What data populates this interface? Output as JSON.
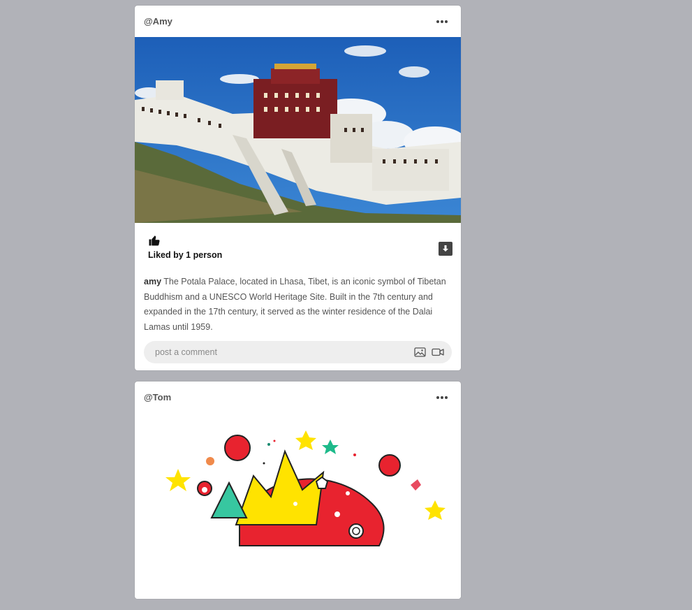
{
  "posts": [
    {
      "username": "@Amy",
      "more_icon": "more-horizontal-icon",
      "image_alt": "Potala Palace",
      "like_icon": "thumbs-up-icon",
      "likes_text": "Liked by 1 person",
      "download_icon": "download-icon",
      "caption_author": "amy",
      "caption_text": " The Potala Palace, located in Lhasa, Tibet, is an iconic symbol of Tibetan Buddhism and a UNESCO World Heritage Site. Built in the 7th century and expanded in the 17th century, it served as the winter residence of the Dalai Lamas until 1959.",
      "comment_placeholder": "post a comment",
      "comment_icons": [
        "image-icon",
        "video-icon"
      ]
    },
    {
      "username": "@Tom",
      "more_icon": "more-horizontal-icon",
      "image_alt": "Colorful cartoon illustration"
    }
  ],
  "colors": {
    "background": "#b1b2b8",
    "card": "#ffffff",
    "comment_bg": "#eeeeee",
    "download_btn": "#444444"
  }
}
